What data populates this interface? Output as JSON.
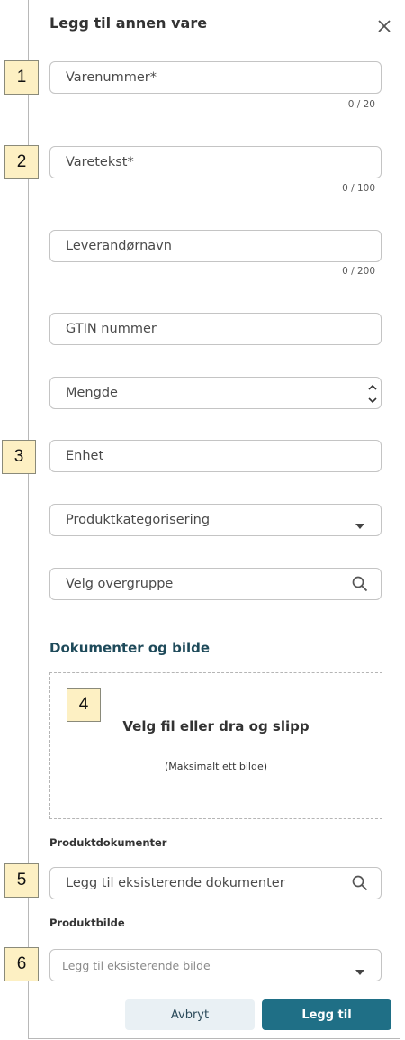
{
  "dialog": {
    "title": "Legg til annen vare",
    "close_icon": "close-icon"
  },
  "fields": {
    "varenummer": {
      "placeholder": "Varenummer*",
      "counter": "0 / 20"
    },
    "varetekst": {
      "placeholder": "Varetekst*",
      "counter": "0 / 100"
    },
    "leverandornavn": {
      "placeholder": "Leverandørnavn",
      "counter": "0 / 200"
    },
    "gtin": {
      "placeholder": "GTIN nummer"
    },
    "mengde": {
      "placeholder": "Mengde",
      "icon": "spinner-arrows-icon"
    },
    "enhet": {
      "placeholder": "Enhet"
    },
    "produktkategorisering": {
      "placeholder": "Produktkategorisering",
      "icon": "dropdown-caret-icon"
    },
    "overgruppe": {
      "placeholder": "Velg overgruppe",
      "icon": "search-icon"
    }
  },
  "documents": {
    "section_title": "Dokumenter og bilde",
    "dropzone_title": "Velg fil eller dra og slipp",
    "dropzone_subtitle": "(Maksimalt ett bilde)",
    "produktdokumenter_label": "Produktdokumenter",
    "produktdokumenter_placeholder": "Legg til eksisterende dokumenter",
    "produktbilde_label": "Produktbilde",
    "produktbilde_placeholder": "Legg til eksisterende bilde"
  },
  "buttons": {
    "cancel": "Avbryt",
    "add": "Legg til"
  },
  "markers": [
    "1",
    "2",
    "3",
    "4",
    "5",
    "6"
  ],
  "colors": {
    "accent": "#1f6f86",
    "section_title": "#1e4a5a",
    "marker_bg": "#fdf0c3",
    "cancel_bg": "#e9f0f4"
  }
}
